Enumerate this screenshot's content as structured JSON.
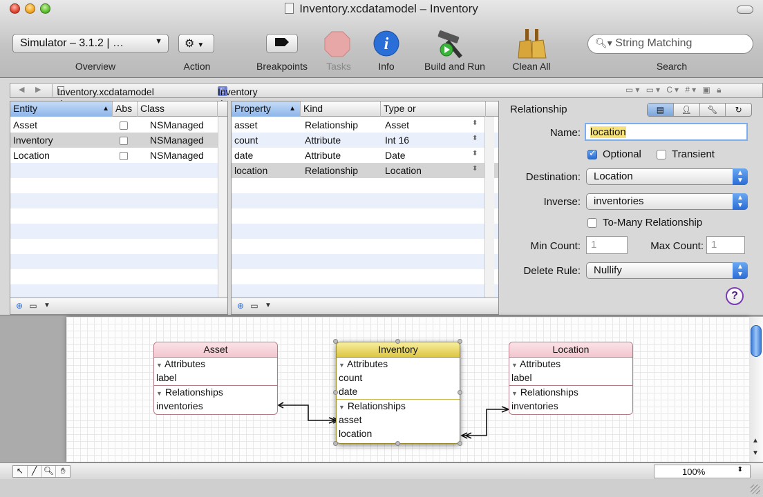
{
  "window": {
    "title": "Inventory.xcdatamodel – Inventory"
  },
  "toolbar": {
    "overview_popup": "Simulator – 3.1.2 | …",
    "items": [
      {
        "label": "Overview"
      },
      {
        "label": "Action"
      },
      {
        "label": "Breakpoints"
      },
      {
        "label": "Tasks"
      },
      {
        "label": "Info"
      },
      {
        "label": "Build and Run"
      },
      {
        "label": "Clean All"
      },
      {
        "label": "Search"
      }
    ],
    "search_placeholder": "String Matching"
  },
  "pathbar": {
    "file": "Inventory.xcdatamodel ≑",
    "entity_badge": "E",
    "entity": "Inventory ≑"
  },
  "entities": {
    "columns": [
      "Entity",
      "Abs",
      "Class"
    ],
    "rows": [
      {
        "entity": "Asset",
        "class": "NSManaged"
      },
      {
        "entity": "Inventory",
        "class": "NSManaged"
      },
      {
        "entity": "Location",
        "class": "NSManaged"
      }
    ]
  },
  "properties": {
    "columns": [
      "Property",
      "Kind",
      "Type or"
    ],
    "rows": [
      {
        "property": "asset",
        "kind": "Relationship",
        "type": "Asset"
      },
      {
        "property": "count",
        "kind": "Attribute",
        "type": "Int 16"
      },
      {
        "property": "date",
        "kind": "Attribute",
        "type": "Date"
      },
      {
        "property": "location",
        "kind": "Relationship",
        "type": "Location"
      }
    ]
  },
  "inspector": {
    "title": "Relationship",
    "name_label": "Name:",
    "name_value": "location",
    "optional_label": "Optional",
    "optional_checked": true,
    "transient_label": "Transient",
    "destination_label": "Destination:",
    "destination_value": "Location",
    "inverse_label": "Inverse:",
    "inverse_value": "inventories",
    "to_many_label": "To-Many Relationship",
    "min_count_label": "Min Count:",
    "min_count_placeholder": "1",
    "max_count_label": "Max Count:",
    "max_count_placeholder": "1",
    "delete_rule_label": "Delete Rule:",
    "delete_rule_value": "Nullify",
    "help": "?"
  },
  "diagram": {
    "entities": [
      {
        "name": "Asset",
        "attributes_header": "Attributes",
        "attributes": [
          "label"
        ],
        "relationships_header": "Relationships",
        "relationships": [
          "inventories"
        ]
      },
      {
        "name": "Inventory",
        "attributes_header": "Attributes",
        "attributes": [
          "count",
          "date"
        ],
        "relationships_header": "Relationships",
        "relationships": [
          "asset",
          "location"
        ]
      },
      {
        "name": "Location",
        "attributes_header": "Attributes",
        "attributes": [
          "label"
        ],
        "relationships_header": "Relationships",
        "relationships": [
          "inventories"
        ]
      }
    ],
    "zoom": "100%"
  },
  "colors": {
    "selection_blue": "#8cb5ea",
    "entity_pink": "#f2c6cf",
    "entity_yellow": "#dcc642",
    "row_alt": "#e9f0fb"
  }
}
